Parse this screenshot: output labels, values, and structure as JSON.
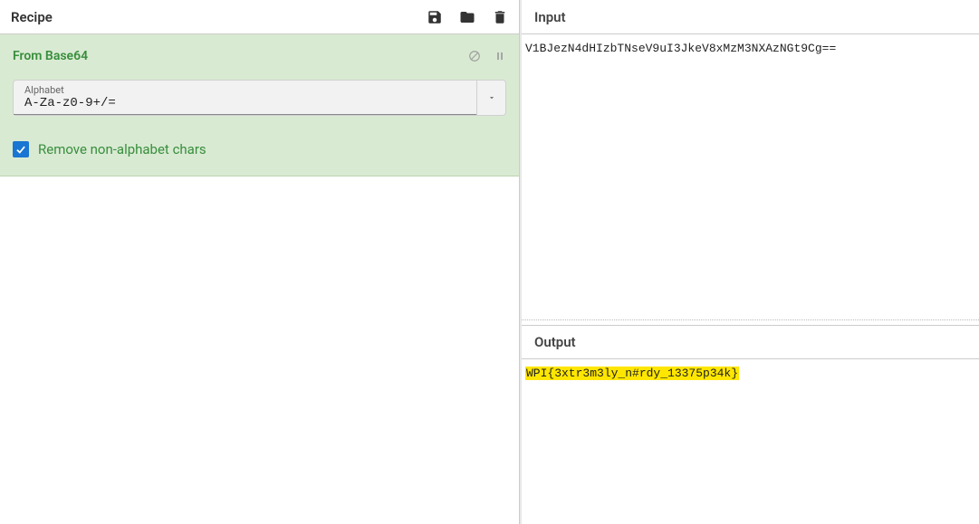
{
  "recipe": {
    "title": "Recipe",
    "icons": {
      "save": "save-icon",
      "open": "folder-icon",
      "clear": "trash-icon"
    }
  },
  "operation": {
    "name": "From Base64",
    "alphabet_label": "Alphabet",
    "alphabet_value": "A-Za-z0-9+/=",
    "checkbox_label": "Remove non-alphabet chars",
    "checkbox_checked": true
  },
  "input": {
    "title": "Input",
    "value": "V1BJezN4dHIzbTNseV9uI3JkeV8xMzM3NXAzNGt9Cg=="
  },
  "output": {
    "title": "Output",
    "value": "WPI{3xtr3m3ly_n#rdy_13375p34k}"
  }
}
